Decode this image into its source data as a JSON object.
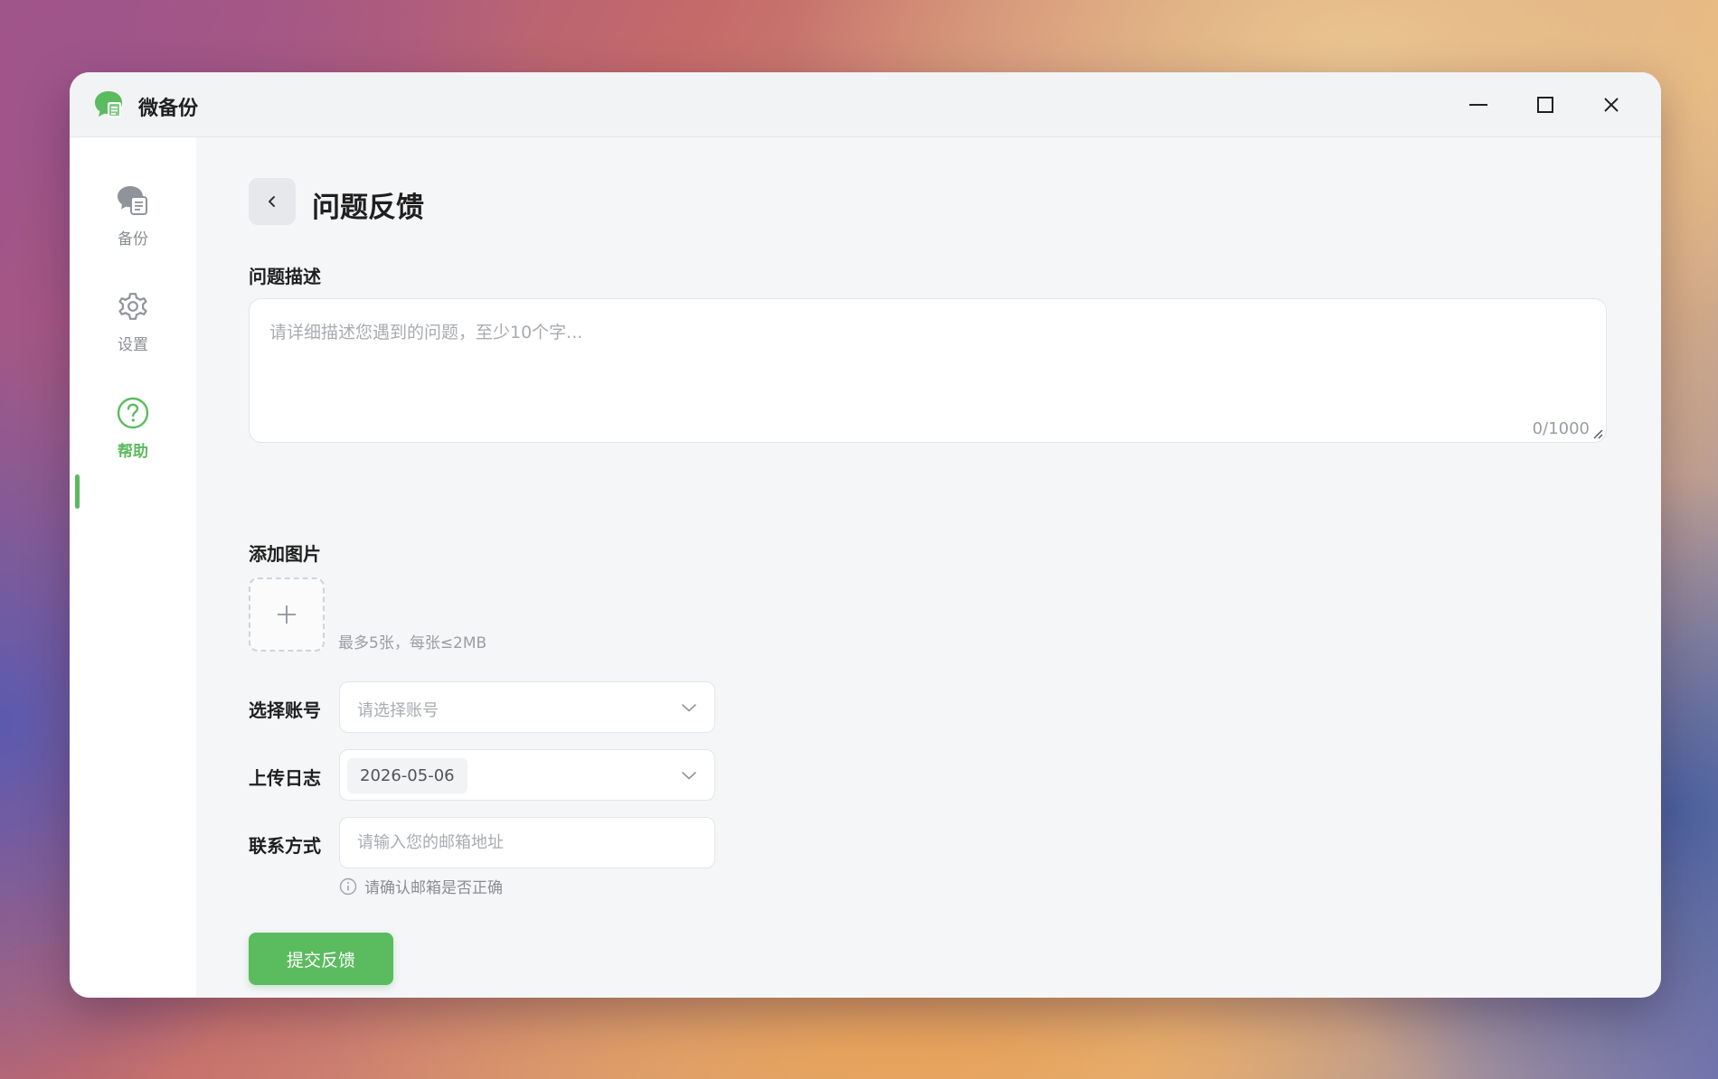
{
  "app": {
    "title": "微备份",
    "accent": "#5bbb5f"
  },
  "window_controls": {
    "minimize": "minimize-icon",
    "maximize": "maximize-icon",
    "close": "close-icon"
  },
  "sidebar": {
    "items": [
      {
        "label": "备份",
        "icon": "chat-backup-icon",
        "active": false
      },
      {
        "label": "设置",
        "icon": "gear-icon",
        "active": false
      },
      {
        "label": "帮助",
        "icon": "question-circle-icon",
        "active": true
      }
    ]
  },
  "page": {
    "title": "问题反馈"
  },
  "form": {
    "description": {
      "label": "问题描述",
      "placeholder": "请详细描述您遇到的问题，至少10个字...",
      "value": "",
      "count": "0/1000"
    },
    "images": {
      "label": "添加图片",
      "hint": "最多5张，每张≤2MB"
    },
    "account": {
      "label": "选择账号",
      "placeholder": "请选择账号"
    },
    "log": {
      "label": "上传日志",
      "value": "2026-05-06"
    },
    "contact": {
      "label": "联系方式",
      "placeholder": "请输入您的邮箱地址",
      "value": "",
      "hint": "请确认邮箱是否正确"
    },
    "submit_label": "提交反馈"
  }
}
